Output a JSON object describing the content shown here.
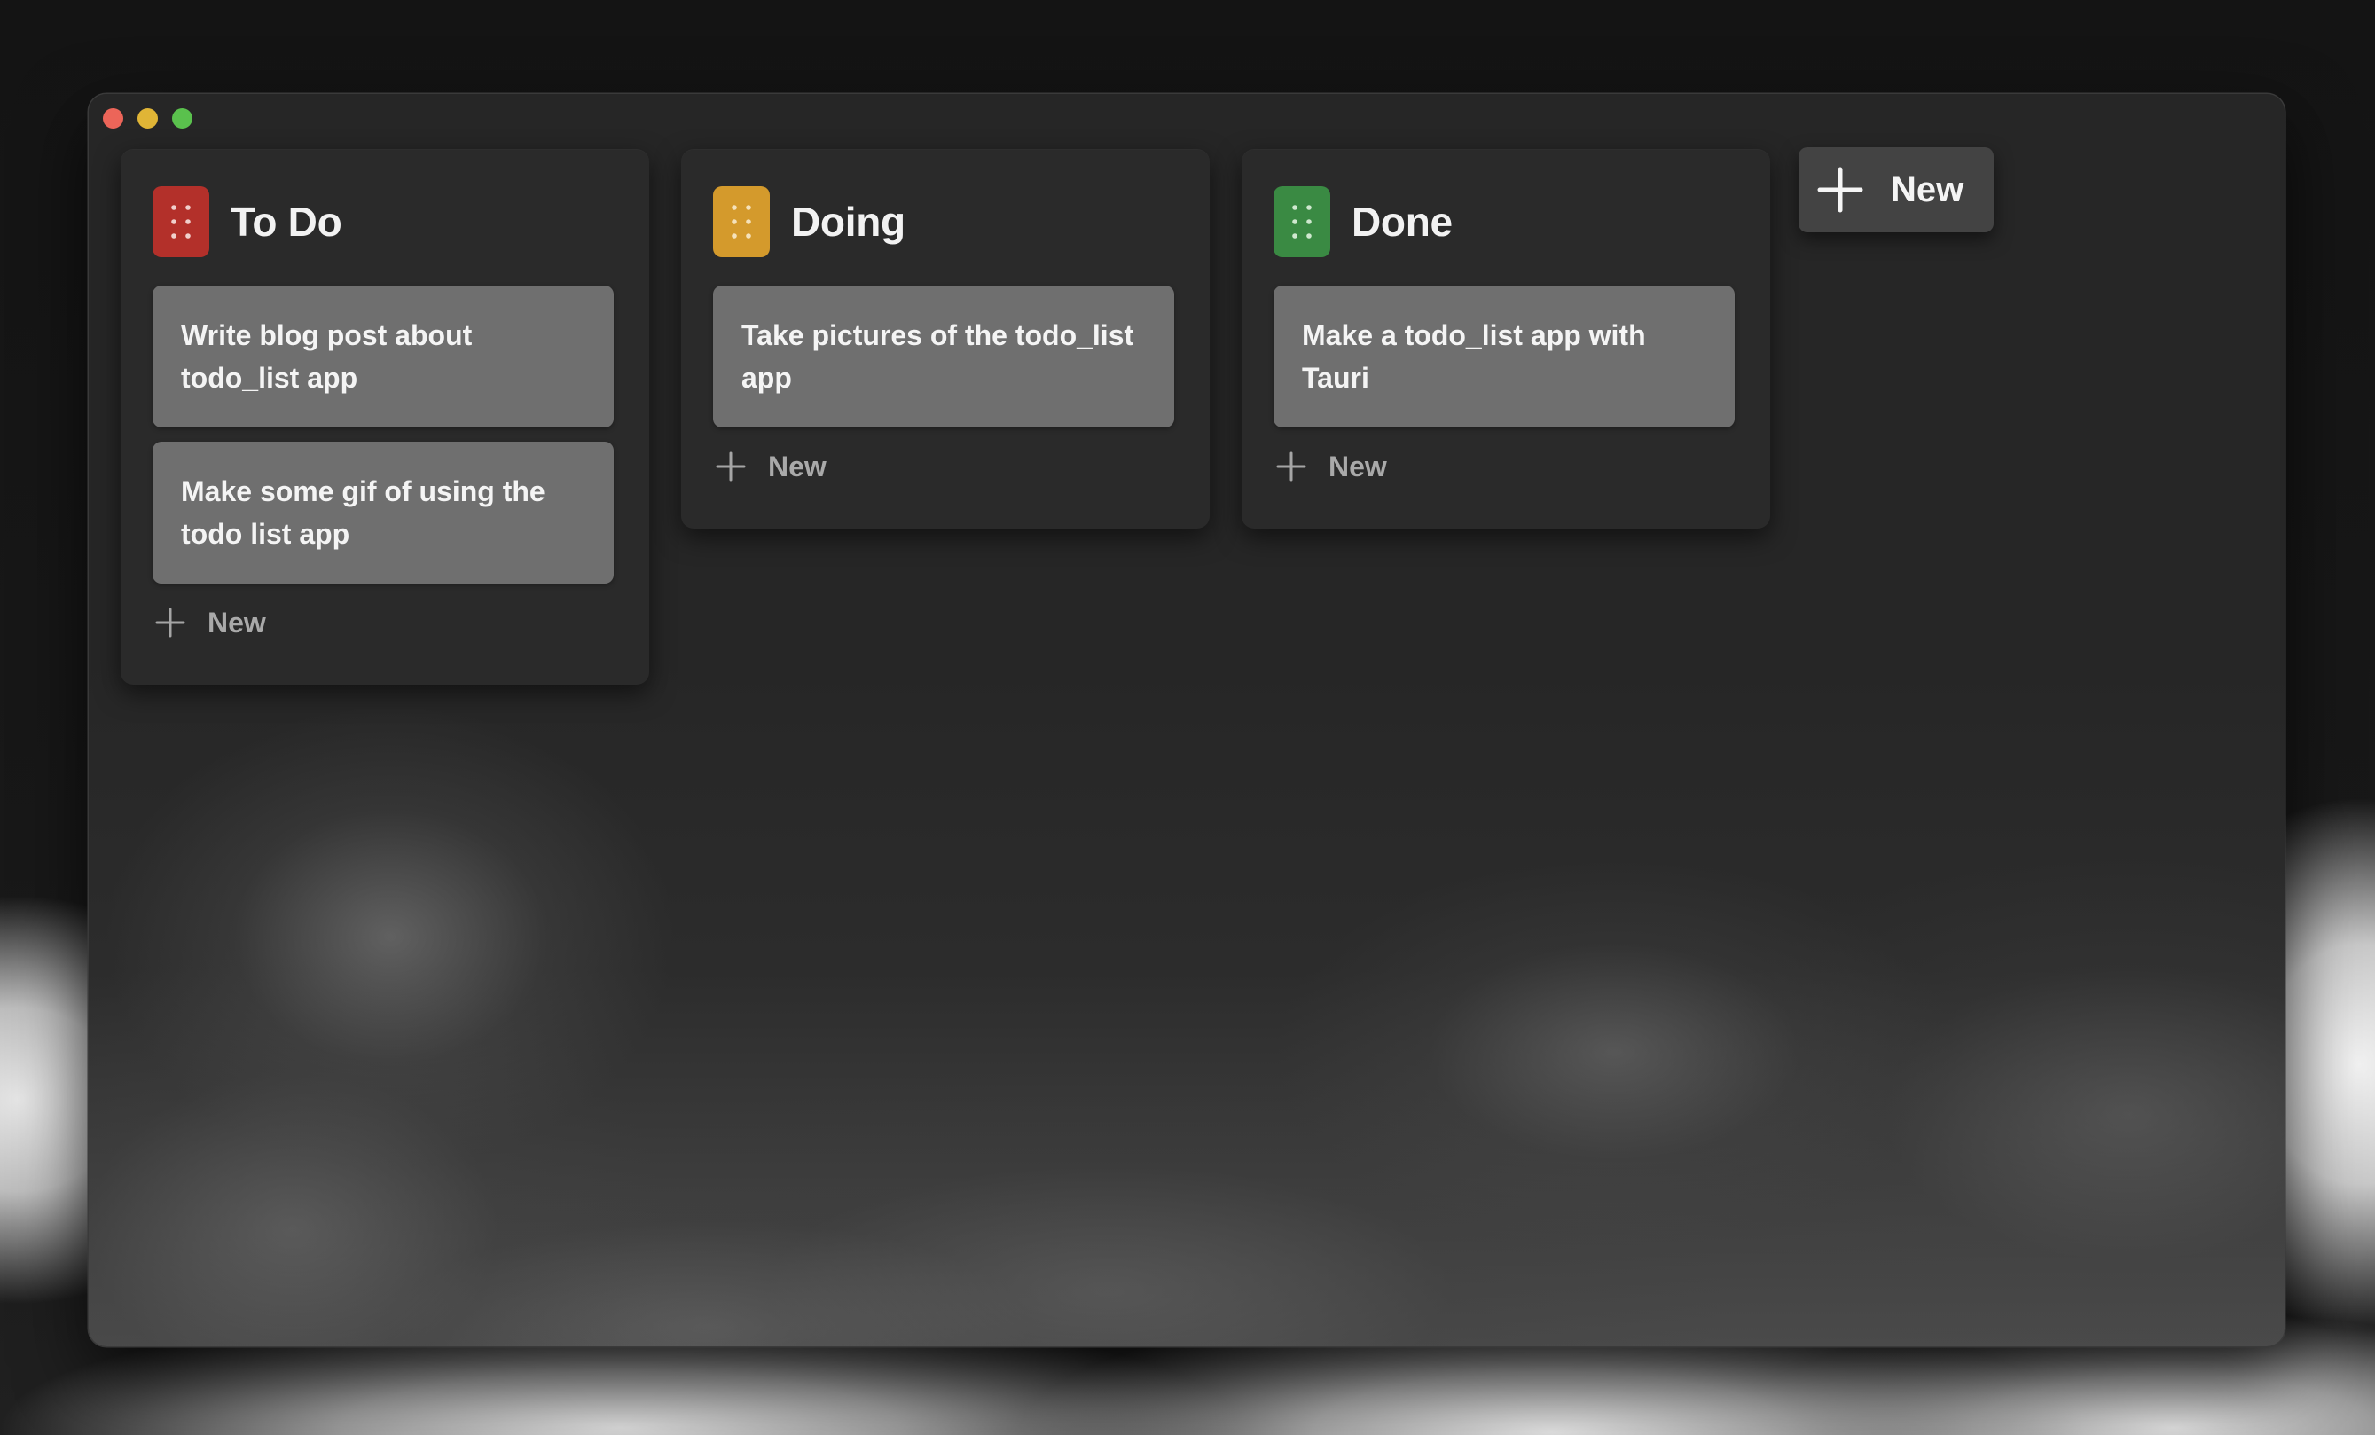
{
  "window": {
    "controls": [
      "close",
      "minimize",
      "maximize"
    ],
    "colors": {
      "close": "#ec6559",
      "minimize": "#e0b536",
      "maximize": "#5ac14d"
    }
  },
  "board": {
    "columns": [
      {
        "title": "To Do",
        "color": "#b3302a",
        "icon": "drag-handle-icon",
        "cards": [
          {
            "text": "Write blog post about todo_list app"
          },
          {
            "text": "Make some gif of using the todo list app"
          }
        ],
        "add_label": "New"
      },
      {
        "title": "Doing",
        "color": "#d49a2c",
        "icon": "drag-handle-icon",
        "cards": [
          {
            "text": "Take pictures of the todo_list app"
          }
        ],
        "add_label": "New"
      },
      {
        "title": "Done",
        "color": "#3a8a43",
        "icon": "drag-handle-icon",
        "cards": [
          {
            "text": "Make a todo_list app with Tauri"
          }
        ],
        "add_label": "New"
      }
    ],
    "new_column_button": {
      "label": "New",
      "icon": "plus-icon"
    }
  }
}
